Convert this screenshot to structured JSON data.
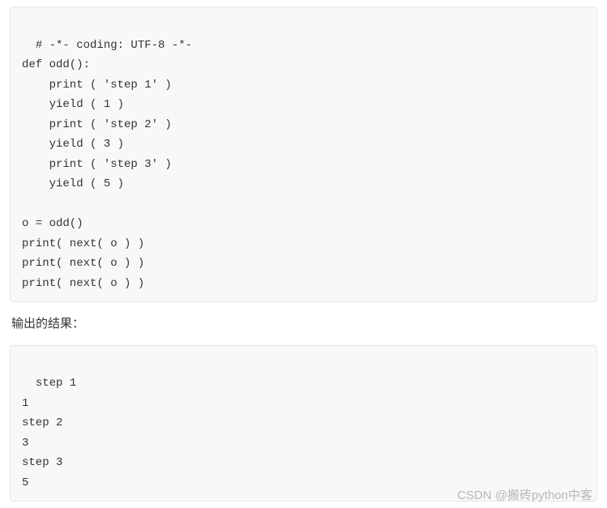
{
  "code_block": {
    "lines": [
      "# -*- coding: UTF-8 -*-",
      "def odd():",
      "    print ( 'step 1' )",
      "    yield ( 1 )",
      "    print ( 'step 2' )",
      "    yield ( 3 )",
      "    print ( 'step 3' )",
      "    yield ( 5 )",
      "",
      "o = odd()",
      "print( next( o ) )",
      "print( next( o ) )",
      "print( next( o ) )"
    ]
  },
  "section_label": "输出的结果：",
  "output_block": {
    "lines": [
      "step 1",
      "1",
      "step 2",
      "3",
      "step 3",
      "5"
    ]
  },
  "watermark": "CSDN @搬砖python中客"
}
